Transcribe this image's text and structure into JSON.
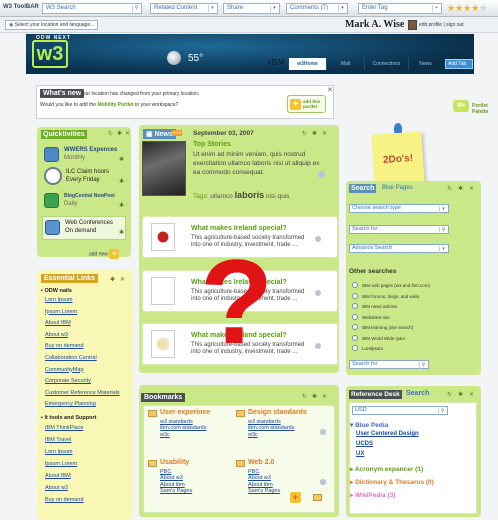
{
  "toolbar": {
    "logo": "W3 ToolBAR",
    "search_label": "W3 Search",
    "related_content": "Related Content",
    "share": "Share",
    "comments": "Comments (7)",
    "enter_tag": "Enter Tag",
    "star_count": 4,
    "stars": "★★★★",
    "star_empty": "★"
  },
  "location_bar": {
    "select_location": "Select your location and language...",
    "user_name": "Mark A. Wise",
    "edit_profile": "edit profile",
    "separator": "|",
    "sign_out": "sign out"
  },
  "banner": {
    "odw_next": "ODW NEXT",
    "logo": "w3",
    "temperature": "55°",
    "ibm": "IBM",
    "nav": [
      "w3Home",
      "Mail",
      "Connections",
      "News"
    ],
    "add_button": "Add Tab"
  },
  "whats_new": {
    "title": "What's new",
    "message": "Your location has changed from your primary location.",
    "question_prefix": "Would you like to add the ",
    "portlet_name": "Mobility Portlet",
    "question_suffix": " to your workspace?",
    "add_label": "add this portlet",
    "close": "✕"
  },
  "portlet_palette": {
    "label": "Portlet Palette"
  },
  "quicktivities": {
    "title": "Quicktivities",
    "items": [
      {
        "label": "WWERS Expences",
        "sub": "Monthly"
      },
      {
        "label": "ILC Claim hours",
        "sub": "Every Friday"
      },
      {
        "label": "BlogCentral NewPost",
        "sub": "Daily"
      },
      {
        "label": "Web Conferences",
        "sub": "On demand"
      }
    ],
    "add_new": "add new"
  },
  "essential_links": {
    "title": "Essential Links",
    "section1": "ODW nails",
    "links1": [
      "Lorn Ipsum",
      "Ipsum Lorem",
      "About IBM",
      "About w3",
      "Buy on demand",
      "Collaboration Central",
      "CommunityMap",
      "Corporate Security",
      "Customer Reference Materials",
      "Emergency Planning"
    ],
    "section2": "It tools and Support",
    "links2": [
      "IBM ThinkPlace",
      "IBM Travel",
      "Lorn Ipsum",
      "Ipsum Lorem",
      "About IBM",
      "About w3",
      "Buy on demand"
    ]
  },
  "news": {
    "title": "News",
    "rss": "RSS",
    "date": "September 03, 2007",
    "top_story_title": "Top Stories",
    "top_story_body": "Ut enim ad minim veniam, quis nostrud exercitation ullamco laboris nisi ut aliquip ex ea commodo consequat.",
    "tags_label": "Tags:",
    "tags": [
      "ullamco",
      "laboris",
      "nisi",
      "quis"
    ],
    "items": [
      {
        "title": "What makes Ireland special?",
        "text": "This agriculture-based society transformed into one of industry, investment, trade ..."
      },
      {
        "title": "What makes Ireland special?",
        "text": "This agriculture-based society transformed into one of industry, investment, trade ..."
      },
      {
        "title": "What makes Ireland special?",
        "text": "This agriculture-based society transformed into one of industry, investment, trade ..."
      }
    ],
    "overlay": "?"
  },
  "todos": {
    "label": "2Do's!"
  },
  "search": {
    "title": "Search",
    "tab": "Blue Pages",
    "choose_type": "Choose search type",
    "search_for": "Search for",
    "advance": "Advance Search",
    "other_title": "Other searches",
    "other": [
      "IBM web pages (w3 and ibm.com)",
      "IBM forums, blogs, and wikis",
      "IBM news articles",
      "Websitest site",
      "IBM learning (site search)",
      "IBM World Wide Q&A",
      "Lorelpsum"
    ],
    "search_for2": "Search for"
  },
  "bookmarks": {
    "title": "Bookmarks",
    "groups": [
      {
        "name": "User experince",
        "links": [
          "w3 standards",
          "ibm.com standards",
          "w3c"
        ]
      },
      {
        "name": "Design standards",
        "links": [
          "w3 standards",
          "ibm.com standards",
          "w3c"
        ]
      },
      {
        "name": "Usability",
        "links": [
          "PBC",
          "About w3",
          "About ibm",
          "Sam's Pages"
        ]
      },
      {
        "name": "Web 2.0",
        "links": [
          "PBC",
          "About w3",
          "About ibm",
          "Sam's Pages"
        ]
      }
    ]
  },
  "reference_desk": {
    "title": "Reference Desk",
    "tab": "Search",
    "query": "USD",
    "blue_pedia": "Blue Pedia",
    "bp_links": [
      "User Centered Design",
      "UCDS",
      "UX"
    ],
    "acronym": "Acronym expancer (1)",
    "dictionary": "Dictionary & Thesarus (0)",
    "wikipedia": "WikiPedia (3)"
  }
}
